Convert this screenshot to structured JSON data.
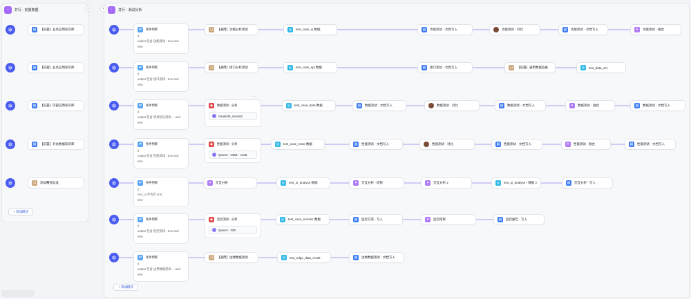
{
  "left_group": {
    "title": "并行 - 前置数据",
    "add_label": "+ 添加模块",
    "rows": [
      {
        "label": "【前置】业务应用知识库",
        "icon": "doc"
      },
      {
        "label": "【前置】业务应用知识库",
        "icon": "doc"
      },
      {
        "label": "【前置】内部应用知识库",
        "icon": "doc"
      },
      {
        "label": "【前置】对比数据知识库",
        "icon": "doc"
      },
      {
        "label": "测试覆盖标准",
        "icon": "tan"
      }
    ]
  },
  "main_group": {
    "title": "并行 - 测试分析",
    "add_label": "+ 添加模块",
    "node_menu": "···",
    "rows": [
      {
        "cond": {
          "title": "条件判断",
          "if": "if",
          "line": "output 包含 功能测试 : true",
          "and": "and",
          "else": "else"
        },
        "nodes": [
          {
            "label": "【通用】功能分析测试",
            "icon": "tan"
          },
          {
            "label": "test_case_ui 数据",
            "icon": "cyan"
          },
          {
            "label": "功能测试 - 文档写入",
            "icon": "doc"
          },
          {
            "label": "功能测试 - 对比",
            "icon": "img"
          },
          {
            "label": "功能测试 - 文档写入",
            "icon": "doc"
          },
          {
            "label": "功能测试 - 融合",
            "icon": "purple"
          }
        ]
      },
      {
        "cond": {
          "title": "条件判断",
          "if": "if",
          "line": "output 包含 接口测试 : true",
          "and": "and",
          "else": "else"
        },
        "nodes": [
          {
            "label": "【通用】接口分析测试",
            "icon": "tan"
          },
          {
            "label": "test_case_api 数据",
            "icon": "cyan"
          },
          {
            "label": "接口测试 - 文档写入",
            "icon": "doc"
          },
          {
            "label": "【前置】通用数据准备",
            "icon": "tan"
          },
          {
            "label": "test_data_set",
            "icon": "cyan"
          }
        ]
      },
      {
        "cond": {
          "title": "条件判断",
          "if": "if",
          "line": "output 包含 项目验证测试 ...",
          "and": "and",
          "else": "else"
        },
        "agent": {
          "title": "数据测试 - 分析",
          "model": "claude35_sonnet2"
        },
        "nodes": [
          {
            "label": "test_case_data 数据",
            "icon": "cyan"
          },
          {
            "label": "数据测试 - 文档写入",
            "icon": "doc"
          },
          {
            "label": "数据测试 - 对比",
            "icon": "img"
          },
          {
            "label": "数据测试 - 文档写入",
            "icon": "doc"
          },
          {
            "label": "数据测试 - 融合",
            "icon": "purple"
          },
          {
            "label": "数据测试 - 文档写入",
            "icon": "doc"
          }
        ]
      },
      {
        "cond": {
          "title": "条件判断",
          "if": "if",
          "line": "output 包含 性能测试 : true",
          "and": "and",
          "else": "else"
        },
        "agent": {
          "title": "性能测试 - 分析",
          "model": "Qwen3 - 235B - A22B"
        },
        "nodes": [
          {
            "label": "test_case_meta 数据",
            "icon": "cyan"
          },
          {
            "label": "性能测试 - 文档写入",
            "icon": "doc"
          },
          {
            "label": "性能测试 - 对比",
            "icon": "img"
          },
          {
            "label": "性能测试 - 文档写入",
            "icon": "doc"
          },
          {
            "label": "性能测试 - 融合",
            "icon": "purple"
          },
          {
            "label": "性能测试 - 文档写入",
            "icon": "doc"
          }
        ]
      },
      {
        "cond": {
          "title": "条件判断",
          "if": "if",
          "line": "test_ui 不为空",
          "and": "and",
          "else": "else"
        },
        "nodes": [
          {
            "label": "交互分析",
            "icon": "purple"
          },
          {
            "label": "test_ui_analyse 数据",
            "icon": "cyan"
          },
          {
            "label": "交互分析 - 结构",
            "icon": "purple"
          },
          {
            "label": "交互分析 2",
            "icon": "purple"
          },
          {
            "label": "test_ui_analyse - 数据 2",
            "icon": "cyan"
          },
          {
            "label": "交互分析 - 写入",
            "icon": "doc"
          }
        ]
      },
      {
        "cond": {
          "title": "条件判断",
          "if": "if",
          "line": "output 包含 监控测试 : true",
          "and": "and",
          "else": "else"
        },
        "agent": {
          "title": "监控测试 - 分析",
          "model": "Qwen3 - 32B"
        },
        "nodes": [
          {
            "label": "test_case_monitor 数据",
            "icon": "cyan"
          },
          {
            "label": "监控方案 - 写入",
            "icon": "doc"
          },
          {
            "label": "监控结果",
            "icon": "purple"
          },
          {
            "label": "监控报告 - 写入",
            "icon": "doc"
          }
        ]
      },
      {
        "cond": {
          "title": "条件判断",
          "if": "if",
          "line": "output 包含 边界数据测试 ...",
          "and": "and",
          "else": "else"
        },
        "nodes": [
          {
            "label": "【通用】边缘数据测试",
            "icon": "tan"
          },
          {
            "label": "test_edge_data_result",
            "icon": "cyan"
          },
          {
            "label": "边缘数据测试 - 文档写入",
            "icon": "doc"
          }
        ]
      }
    ]
  },
  "colors": {
    "accent": "#4a5cf0",
    "group_pill": "#a56bf7",
    "edge": "#8a7cf0"
  },
  "icons": {
    "start": "start-icon",
    "collapse": "collapse-icon",
    "doc": "doc-icon",
    "cyan": "data-icon",
    "purple": "llm-icon",
    "tan": "knowledge-icon",
    "img": "compare-icon",
    "red": "agent-icon"
  }
}
